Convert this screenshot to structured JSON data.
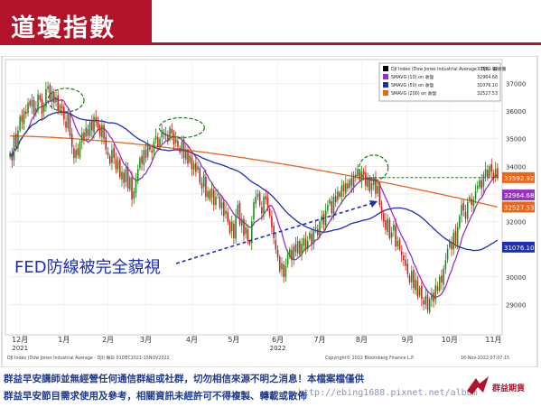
{
  "header": {
    "title": "道瓊指數"
  },
  "annotation": {
    "text": "FED防線被完全藐視"
  },
  "footer": {
    "line1": "群益早安講師並無經營任何通信群組或社群，切勿相信來源不明之消息！本檔案檔僅供",
    "line2": "群益早安節目需求使用及參考，相關資訊未經許可不得複製、轉載或散佈",
    "brand": "群益期貨",
    "watermark": "http://ebing1688.pixnet.net/album"
  },
  "chart_data": {
    "type": "candlestick",
    "ylim": [
      28000,
      37800
    ],
    "yticks": [
      29000,
      30000,
      31000,
      32000,
      33000,
      34000,
      35000,
      36000,
      37000
    ],
    "xticks": [
      {
        "label": "12月",
        "sub": "2021",
        "i": 5
      },
      {
        "label": "1月",
        "i": 27
      },
      {
        "label": "2月",
        "i": 49
      },
      {
        "label": "3月",
        "i": 68
      },
      {
        "label": "4月",
        "i": 91
      },
      {
        "label": "5月",
        "i": 112
      },
      {
        "label": "6月",
        "sub": "2022",
        "i": 134
      },
      {
        "label": "7月",
        "i": 155
      },
      {
        "label": "8月",
        "i": 176
      },
      {
        "label": "9月",
        "i": 199
      },
      {
        "label": "10月",
        "i": 220
      },
      {
        "label": "11月",
        "i": 242
      }
    ],
    "closes": [
      34480,
      34200,
      35100,
      34700,
      35300,
      35800,
      35600,
      36000,
      35900,
      36300,
      36200,
      36400,
      35900,
      36100,
      36600,
      36400,
      35900,
      36200,
      36800,
      36900,
      36400,
      36700,
      36300,
      36500,
      36000,
      36200,
      36100,
      35700,
      35400,
      35900,
      35100,
      34700,
      34300,
      34600,
      34400,
      34900,
      35200,
      35000,
      35400,
      35100,
      35600,
      35300,
      35800,
      35600,
      35400,
      35100,
      35500,
      35000,
      34600,
      34400,
      34100,
      34600,
      34300,
      33900,
      34200,
      33600,
      33800,
      33400,
      33900,
      33200,
      33600,
      32800,
      33100,
      33500,
      33900,
      34300,
      34100,
      34600,
      34300,
      34800,
      34600,
      34500,
      34900,
      35100,
      34700,
      35000,
      35300,
      35200,
      35100,
      34900,
      35400,
      35200,
      34800,
      35000,
      34700,
      34500,
      34900,
      34300,
      34600,
      34100,
      34400,
      33900,
      34100,
      33800,
      34000,
      33400,
      33200,
      33700,
      32900,
      33100,
      32800,
      33200,
      32600,
      32900,
      33000,
      32500,
      32700,
      32200,
      32400,
      32000,
      31600,
      32000,
      31400,
      32200,
      32600,
      31900,
      32100,
      31500,
      31800,
      31300,
      31200,
      32000,
      32700,
      32900,
      33000,
      32600,
      32300,
      32900,
      32800,
      32500,
      32200,
      31800,
      31400,
      31000,
      30700,
      30200,
      30500,
      30000,
      30400,
      30800,
      31000,
      30600,
      31100,
      30900,
      31300,
      30800,
      31200,
      31400,
      31000,
      31300,
      31600,
      31200,
      31700,
      31800,
      31500,
      32000,
      32200,
      31900,
      32400,
      32600,
      32800,
      32300,
      32900,
      32700,
      33100,
      32900,
      33300,
      33100,
      33400,
      33200,
      33500,
      33300,
      33700,
      33600,
      33900,
      33500,
      33800,
      33700,
      33300,
      33600,
      33100,
      33400,
      33600,
      33000,
      33300,
      32600,
      32300,
      32000,
      31700,
      32100,
      31400,
      31600,
      31900,
      31100,
      31300,
      31000,
      30800,
      30600,
      30400,
      30100,
      29800,
      30200,
      29600,
      29900,
      29300,
      29600,
      29200,
      29000,
      29300,
      28800,
      29200,
      29400,
      29100,
      29700,
      29500,
      30000,
      29800,
      30300,
      30600,
      31000,
      31300,
      31000,
      31600,
      31200,
      31800,
      32200,
      32600,
      32400,
      32100,
      32700,
      32900,
      32600,
      32800,
      33100,
      33300,
      33500,
      33200,
      33700,
      33900,
      33600,
      34000,
      33800,
      33600,
      33900,
      33593
    ],
    "series": [
      {
        "name": "DJI Index (Dow Jones Industrial Average - DJI) - 最新價",
        "key": "price",
        "last": 33592.92,
        "color": "#000000"
      },
      {
        "name": "SMAVG (10) on 收盤",
        "key": "ma10",
        "last": 32964.68,
        "color": "#9b30c6"
      },
      {
        "name": "SMAVG (50) on 收盤",
        "key": "ma50",
        "last": 31076.1,
        "color": "#1a2fb8"
      },
      {
        "name": "SMAVG (200) on 收盤",
        "key": "ma200",
        "last": 32527.53,
        "color": "#e8651a"
      }
    ],
    "price_labels": [
      {
        "text": "33592.92",
        "value": 33592.92,
        "bg": "#e8651a"
      },
      {
        "text": "32964.68",
        "value": 32964.68,
        "bg": "#9b30c6"
      },
      {
        "text": "32527.53",
        "value": 32527.53,
        "bg": "#e8651a"
      },
      {
        "text": "31076.10",
        "value": 31076.1,
        "bg": "#1a2fb8"
      }
    ],
    "source_left": "DJI Index (Dow Jones Industrial Average - DJI) 每日 01DEC2021-15NOV2022",
    "source_right": "16-Nov-2022 07:07:15",
    "copyright": "Copyright© 2022 Bloomberg Finance L.P.",
    "up_color": "#1a8a1a",
    "down_color": "#d21a1a"
  }
}
